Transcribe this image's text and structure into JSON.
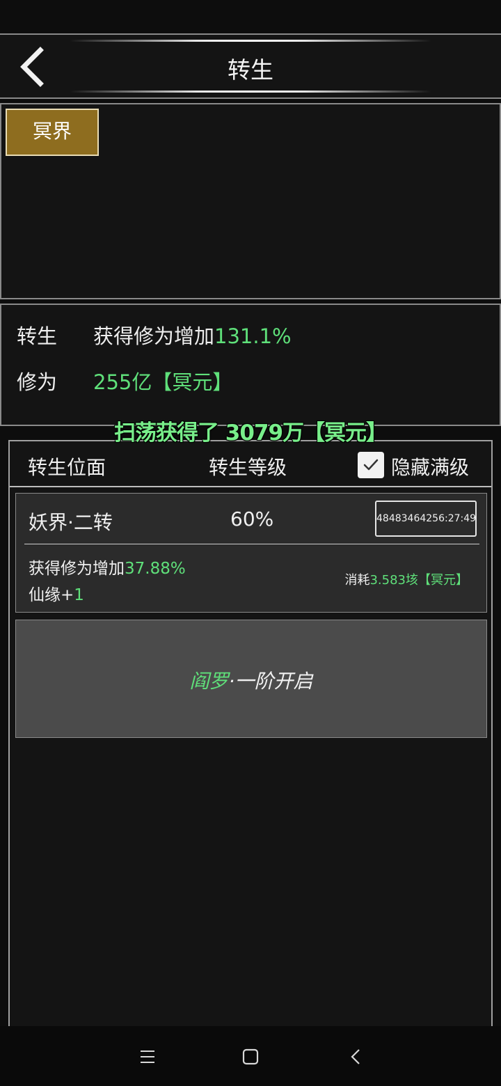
{
  "header": {
    "title": "转生",
    "back_icon": "chevron-left-icon"
  },
  "realm_tabs": [
    {
      "label": "冥界",
      "selected": true,
      "color": "#8e6d1f"
    }
  ],
  "info": {
    "rebirth_label": "转生",
    "rebirth_text": "获得修为增加",
    "rebirth_value": "131.1%",
    "cultivation_label": "修为",
    "cultivation_value": "255亿【冥元】"
  },
  "sweep_banner": "扫荡获得了 3079万【冥元】",
  "list": {
    "col_plane": "转生位面",
    "col_level": "转生等级",
    "hide_max_label": "隐藏满级",
    "hide_max_checked": true,
    "items": [
      {
        "name": "妖界·二转",
        "level_pct": "60%",
        "timer": "48483464256:27:49",
        "gain_text": "获得修为增加",
        "gain_value": "37.88%",
        "fate_text": "仙缘+",
        "fate_value": "1",
        "cost_text": "消耗",
        "cost_value": "3.583垓【冥元】"
      }
    ],
    "locked": {
      "highlight": "阎罗",
      "rest": "·一阶开启"
    }
  },
  "nav": {
    "menu_icon": "menu-icon",
    "home_icon": "home-square-icon",
    "back_icon": "back-chevron-icon"
  },
  "colors": {
    "accent_green": "#5fe07a",
    "tab_gold": "#8e6d1f",
    "panel_bg": "#141414"
  }
}
